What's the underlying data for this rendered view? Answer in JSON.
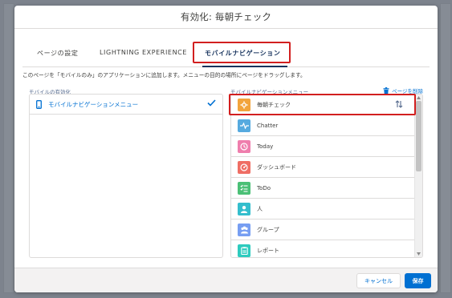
{
  "modal": {
    "title": "有効化: 毎朝チェック"
  },
  "tabs": [
    {
      "label": "ページの設定"
    },
    {
      "label": "LIGHTNING EXPERIENCE"
    },
    {
      "label": "モバイルナビゲーション"
    }
  ],
  "description": "このページを「モバイルのみ」のアプリケーションに追加します。メニューの目的の場所にページをドラッグします。",
  "mobile_activation": {
    "label": "モバイルの有効化",
    "item_label": "モバイルナビゲーションメニュー"
  },
  "nav_menu": {
    "label": "モバイルナビゲーションメニュー",
    "remove_label": "ページを削除",
    "items": [
      {
        "label": "毎朝チェック",
        "icon": "lightning-page-icon",
        "color": "#f2a43c"
      },
      {
        "label": "Chatter",
        "icon": "pulse-icon",
        "color": "#56aadf"
      },
      {
        "label": "Today",
        "icon": "clock-icon",
        "color": "#ef7ead"
      },
      {
        "label": "ダッシュボード",
        "icon": "gauge-icon",
        "color": "#ef6e64"
      },
      {
        "label": "ToDo",
        "icon": "checklist-icon",
        "color": "#4bc076"
      },
      {
        "label": "人",
        "icon": "person-icon",
        "color": "#34becd"
      },
      {
        "label": "グループ",
        "icon": "group-icon",
        "color": "#779ef2"
      },
      {
        "label": "レポート",
        "icon": "report-icon",
        "color": "#2ecbbe"
      }
    ]
  },
  "footer": {
    "cancel": "キャンセル",
    "save": "保存"
  },
  "colors": {
    "brand": "#0070d2",
    "highlight": "#d21f1f"
  }
}
